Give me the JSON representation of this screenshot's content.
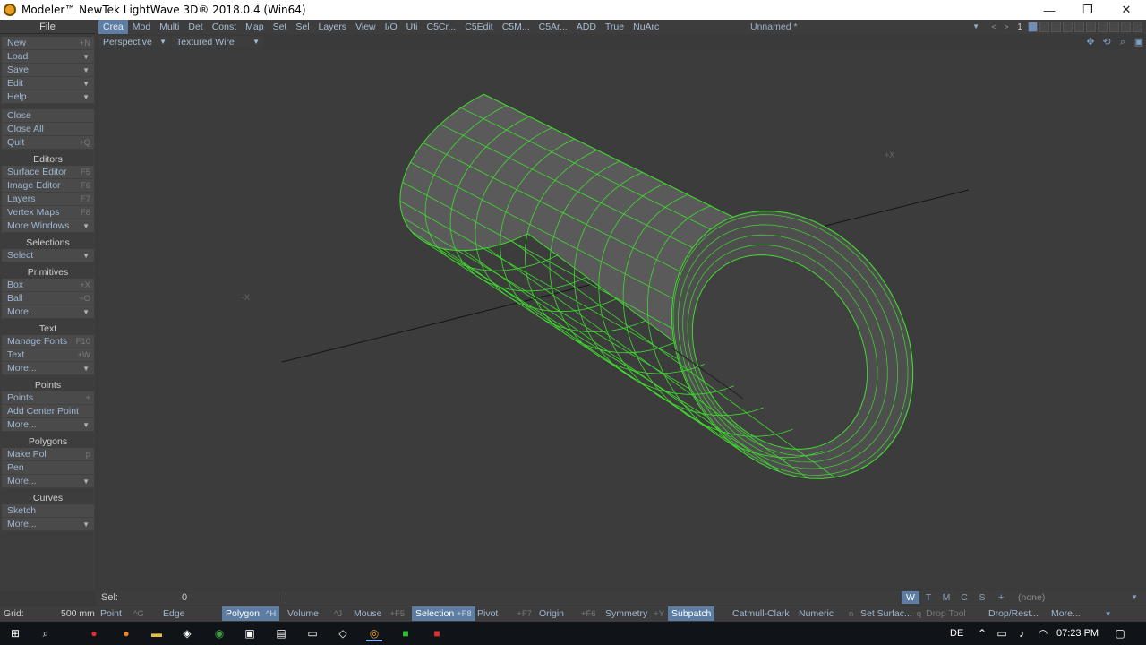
{
  "window": {
    "title": "Modeler™ NewTek LightWave 3D® 2018.0.4 (Win64)",
    "minimize": "—",
    "restore": "❐",
    "close": "✕"
  },
  "menubar": {
    "file_label": "File",
    "tabs": [
      "Crea",
      "Mod",
      "Multi",
      "Det",
      "Const",
      "Map",
      "Set",
      "Sel",
      "Layers",
      "View",
      "I/O",
      "Uti",
      "C5Cr...",
      "C5Edit",
      "C5M...",
      "C5Ar...",
      "ADD",
      "True",
      "NuArc"
    ],
    "active_tab": "Crea",
    "layer_name": "Unnamed *",
    "layer_number": "1"
  },
  "viewport": {
    "view_mode": "Perspective",
    "shading_mode": "Textured Wire",
    "axis_label_x_pos": "+X",
    "axis_label_x_neg": "-X",
    "wire_color": "#3fdc2e",
    "surface_color": "#5a5a5a"
  },
  "toolbar": {
    "groups": [
      {
        "title": "",
        "items": [
          {
            "label": "New",
            "shortcut": "+N"
          },
          {
            "label": "Load",
            "shortcut": "▼"
          },
          {
            "label": "Save",
            "shortcut": "▼"
          },
          {
            "label": "Edit",
            "shortcut": "▼"
          },
          {
            "label": "Help",
            "shortcut": "▼"
          }
        ]
      },
      {
        "title": "",
        "items": [
          {
            "label": "Close",
            "shortcut": ""
          },
          {
            "label": "Close All",
            "shortcut": ""
          },
          {
            "label": "Quit",
            "shortcut": "+Q"
          }
        ]
      },
      {
        "title": "Editors",
        "items": [
          {
            "label": "Surface Editor",
            "shortcut": "F5"
          },
          {
            "label": "Image Editor",
            "shortcut": "F6"
          },
          {
            "label": "Layers",
            "shortcut": "F7"
          },
          {
            "label": "Vertex Maps",
            "shortcut": "F8"
          },
          {
            "label": "More Windows",
            "shortcut": "▼"
          }
        ]
      },
      {
        "title": "Selections",
        "items": [
          {
            "label": "Select",
            "shortcut": "▼"
          }
        ]
      },
      {
        "title": "Primitives",
        "items": [
          {
            "label": "Box",
            "shortcut": "+X"
          },
          {
            "label": "Ball",
            "shortcut": "+O"
          },
          {
            "label": "More...",
            "shortcut": "▼"
          }
        ]
      },
      {
        "title": "Text",
        "items": [
          {
            "label": "Manage Fonts",
            "shortcut": "F10"
          },
          {
            "label": "Text",
            "shortcut": "+W"
          },
          {
            "label": "More...",
            "shortcut": "▼"
          }
        ]
      },
      {
        "title": "Points",
        "items": [
          {
            "label": "Points",
            "shortcut": "+"
          },
          {
            "label": "Add Center Point",
            "shortcut": ""
          },
          {
            "label": "More...",
            "shortcut": "▼"
          }
        ]
      },
      {
        "title": "Polygons",
        "items": [
          {
            "label": "Make Pol",
            "shortcut": "p"
          },
          {
            "label": "Pen",
            "shortcut": ""
          },
          {
            "label": "More...",
            "shortcut": "▼"
          }
        ]
      },
      {
        "title": "Curves",
        "items": [
          {
            "label": "Sketch",
            "shortcut": ""
          },
          {
            "label": "More...",
            "shortcut": "▼"
          }
        ]
      }
    ]
  },
  "selbar": {
    "label": "Sel:",
    "value": "0",
    "modes": [
      "W",
      "T",
      "M",
      "C",
      "S"
    ],
    "active_mode": "W",
    "plus": "+",
    "surface": "(none)"
  },
  "statusbar": {
    "grid_label": "Grid:",
    "grid_value": "500 mm",
    "point": "Point",
    "point_key": "^G",
    "edge": "Edge",
    "polygon": "Polygon",
    "polygon_key": "^H",
    "volume": "Volume",
    "volume_key": "^J",
    "mouse": "Mouse",
    "mouse_key": "+F5",
    "selection": "Selection",
    "selection_key": "+F8",
    "pivot": "Pivot",
    "pivot_key": "+F7",
    "origin": "Origin",
    "origin_key": "+F6",
    "symmetry": "Symmetry",
    "symmetry_key": "+Y",
    "subpatch": "Subpatch",
    "catmull": "Catmull-Clark",
    "numeric": "Numeric",
    "numeric_key": "n",
    "set_surface": "Set Surfac...",
    "set_surface_key": "q",
    "drop_tool": "Drop Tool",
    "drop_rest": "Drop/Rest...",
    "more": "More..."
  },
  "taskbar": {
    "language": "DE",
    "time": "07:23 PM"
  }
}
